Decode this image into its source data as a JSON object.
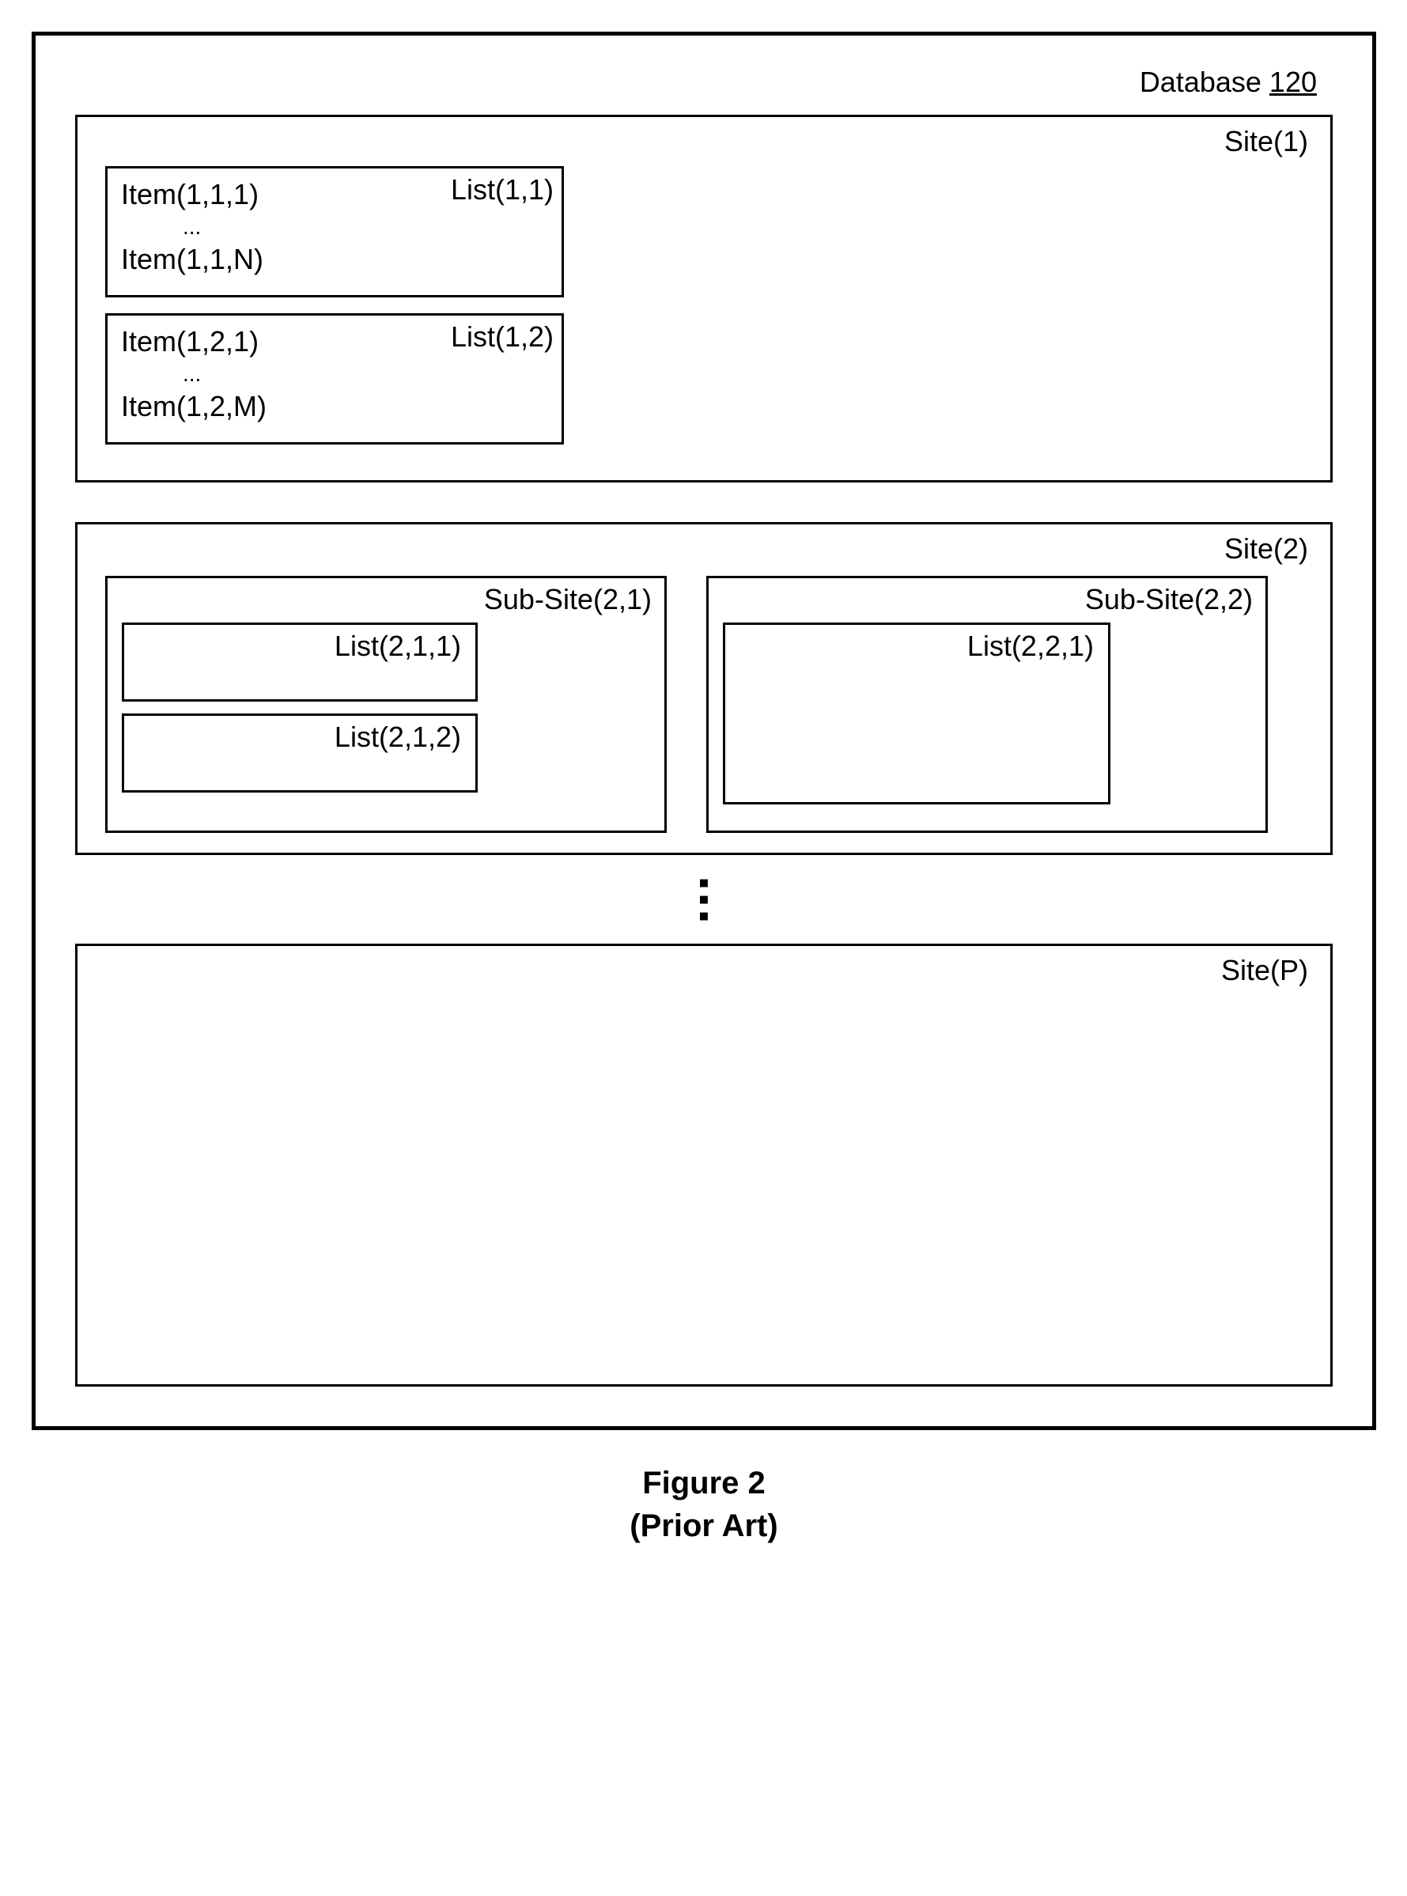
{
  "database": {
    "label_prefix": "Database ",
    "label_num": "120"
  },
  "site1": {
    "label": "Site(1)",
    "list1": {
      "label": "List(1,1)",
      "item_first": "Item(1,1,1)",
      "ellipsis": "...",
      "item_last": "Item(1,1,N)"
    },
    "list2": {
      "label": "List(1,2)",
      "item_first": "Item(1,2,1)",
      "ellipsis": "...",
      "item_last": "Item(1,2,M)"
    }
  },
  "site2": {
    "label": "Site(2)",
    "subsite1": {
      "label": "Sub-Site(2,1)",
      "list1": {
        "label": "List(2,1,1)"
      },
      "list2": {
        "label": "List(2,1,2)"
      }
    },
    "subsite2": {
      "label": "Sub-Site(2,2)",
      "list1": {
        "label": "List(2,2,1)"
      }
    }
  },
  "vdots": {
    "d1": "▪",
    "d2": "▪",
    "d3": "▪"
  },
  "siteP": {
    "label": "Site(P)"
  },
  "caption": {
    "line1": "Figure 2",
    "line2": "(Prior Art)"
  }
}
